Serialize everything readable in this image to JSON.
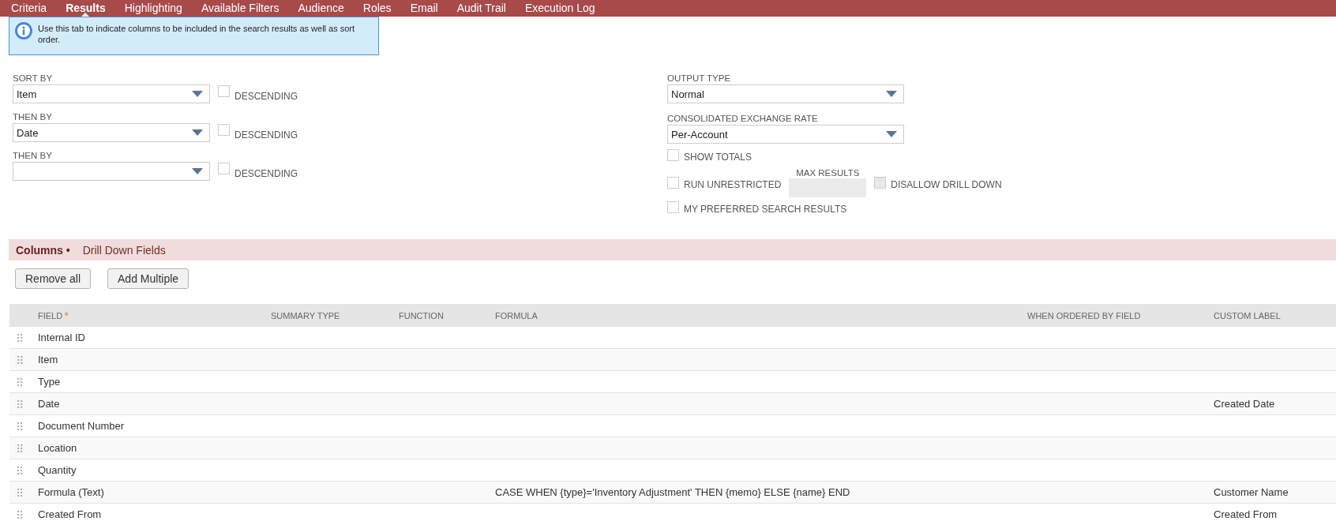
{
  "tabs": [
    {
      "label": "Criteria",
      "selected": false
    },
    {
      "label": "Results",
      "selected": true
    },
    {
      "label": "Highlighting",
      "selected": false
    },
    {
      "label": "Available Filters",
      "selected": false
    },
    {
      "label": "Audience",
      "selected": false
    },
    {
      "label": "Roles",
      "selected": false
    },
    {
      "label": "Email",
      "selected": false
    },
    {
      "label": "Audit Trail",
      "selected": false
    },
    {
      "label": "Execution Log",
      "selected": false
    }
  ],
  "info": "Use this tab to indicate columns to be included in the search results as well as sort order.",
  "sort": [
    {
      "label": "SORT BY",
      "value": "Item",
      "descending_label": "DESCENDING",
      "checked": false
    },
    {
      "label": "THEN BY",
      "value": "Date",
      "descending_label": "DESCENDING",
      "checked": false
    },
    {
      "label": "THEN BY",
      "descending_label": "DESCENDING",
      "checked": false
    }
  ],
  "output": {
    "output_type_label": "OUTPUT TYPE",
    "output_type": "Normal",
    "exchange_label": "CONSOLIDATED EXCHANGE RATE",
    "exchange": "Per-Account",
    "show_totals": {
      "label": "SHOW TOTALS",
      "checked": false
    },
    "max_results_label": "MAX RESULTS",
    "run_unrestricted": {
      "label": "RUN UNRESTRICTED",
      "checked": false
    },
    "disallow_drill_down": {
      "label": "DISALLOW DRILL DOWN",
      "checked": false,
      "disabled": true
    },
    "preferred": {
      "label": "MY PREFERRED SEARCH RESULTS",
      "checked": false
    }
  },
  "subtabs": [
    {
      "label": "Columns •",
      "selected": true
    },
    {
      "label": "Drill Down Fields",
      "selected": false
    }
  ],
  "buttons": [
    "Remove all",
    "Add Multiple"
  ],
  "table": {
    "columns": [
      "FIELD",
      "SUMMARY TYPE",
      "FUNCTION",
      "FORMULA",
      "WHEN ORDERED BY FIELD",
      "CUSTOM LABEL"
    ],
    "required_mark": "*",
    "rows": [
      [
        "Internal ID",
        "",
        "",
        "",
        "",
        ""
      ],
      [
        "Item",
        "",
        "",
        "",
        "",
        ""
      ],
      [
        "Type",
        "",
        "",
        "",
        "",
        ""
      ],
      [
        "Date",
        "",
        "",
        "",
        "",
        "Created Date"
      ],
      [
        "Document Number",
        "",
        "",
        "",
        "",
        ""
      ],
      [
        "Location",
        "",
        "",
        "",
        "",
        ""
      ],
      [
        "Quantity",
        "",
        "",
        "",
        "",
        ""
      ],
      [
        "Formula (Text)",
        "",
        "",
        "CASE WHEN {type}='Inventory Adjustment' THEN {memo} ELSE {name} END",
        "",
        "Customer Name"
      ],
      [
        "Created From",
        "",
        "",
        "",
        "",
        "Created From"
      ]
    ]
  }
}
